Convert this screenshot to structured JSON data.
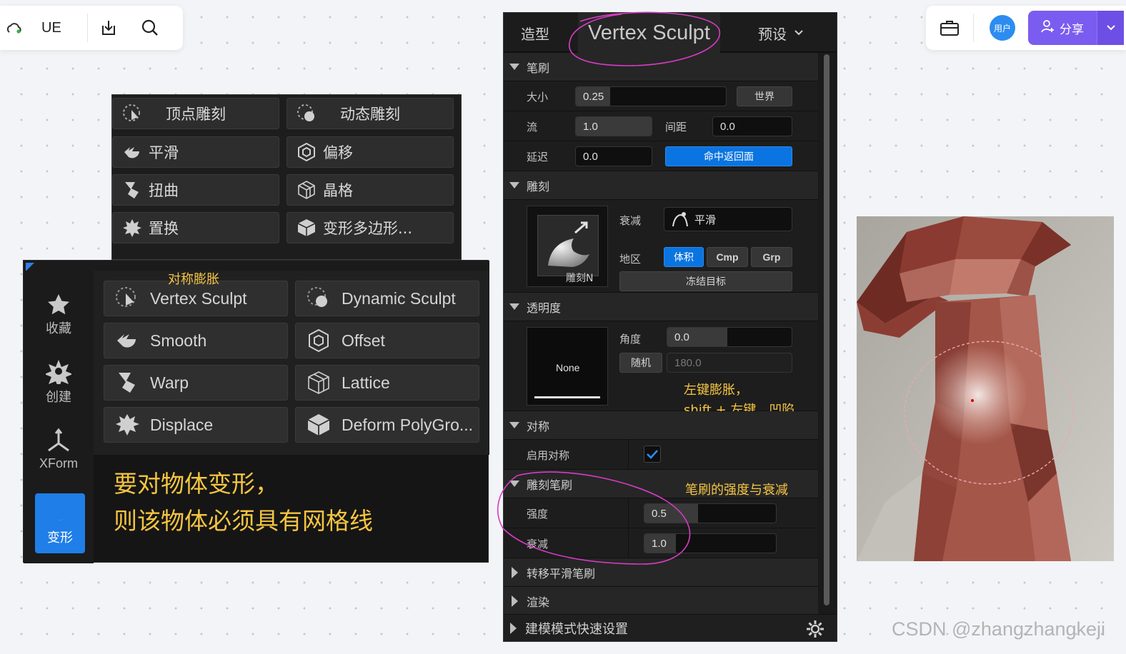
{
  "toolbar_left": {
    "app_name": "UE",
    "icons": [
      "cloud-status-icon",
      "download-icon",
      "search-icon"
    ]
  },
  "toolbar_right": {
    "avatar_text": "用户",
    "share_label": "分享",
    "icons": [
      "briefcase-icon",
      "add-user-icon",
      "chevron-down-icon"
    ]
  },
  "cn_modes": {
    "items": [
      "顶点雕刻",
      "动态雕刻",
      "平滑",
      "偏移",
      "扭曲",
      "晶格",
      "置换",
      "变形多边形..."
    ]
  },
  "en_modes": {
    "annotation_top": "对称膨胀",
    "sidebar": [
      "收藏",
      "创建",
      "XForm",
      "变形"
    ],
    "items": [
      "Vertex Sculpt",
      "Dynamic Sculpt",
      "Smooth",
      "Offset",
      "Warp",
      "Lattice",
      "Displace",
      "Deform PolyGro..."
    ],
    "note_line1": "要对物体变形，",
    "note_line2": "则该物体必须具有网格线"
  },
  "details": {
    "tab_model": "造型",
    "tab_active": "Vertex Sculpt",
    "tab_preset": "预设",
    "brush": {
      "title": "笔刷",
      "size_label": "大小",
      "size_value": "0.25",
      "world_button": "世界",
      "flow_label": "流",
      "flow_value": "1.0",
      "spacing_label": "间距",
      "spacing_value": "0.0",
      "lag_label": "延迟",
      "lag_value": "0.0",
      "hit_back_button": "命中返回面"
    },
    "sculpt": {
      "title": "雕刻",
      "thumb_label": "雕刻N",
      "falloff_label": "衰减",
      "falloff_value": "平滑",
      "region_label": "地区",
      "region_options": [
        "体积",
        "Cmp",
        "Grp"
      ],
      "freeze_button": "冻结目标"
    },
    "alpha": {
      "title": "透明度",
      "thumb_label": "None",
      "angle_label": "角度",
      "angle_value": "0.0",
      "random_button": "随机",
      "random_value": "180.0",
      "note_line1": "左键膨胀，",
      "note_line2": "shift + 左键，凹陷"
    },
    "symmetry": {
      "title": "对称",
      "enable_label": "启用对称",
      "enabled": true
    },
    "sculpt_brush": {
      "title": "雕刻笔刷",
      "note": "笔刷的强度与衰减",
      "strength_label": "强度",
      "strength_value": "0.5",
      "strength_fraction": 0.41,
      "falloff_label": "衰减",
      "falloff_value": "1.0"
    },
    "collapsed": [
      "转移平滑笔刷",
      "渲染"
    ],
    "footer": "建模模式快速设置"
  },
  "watermark": "CSDN @zhangzhangkeji",
  "colors": {
    "accent_blue": "#0a74e0",
    "annotation_yellow": "#f5c542",
    "annotation_pink": "#d63cc4",
    "share_purple": "#7b5cf0",
    "mesh_red": "#a0544a"
  }
}
